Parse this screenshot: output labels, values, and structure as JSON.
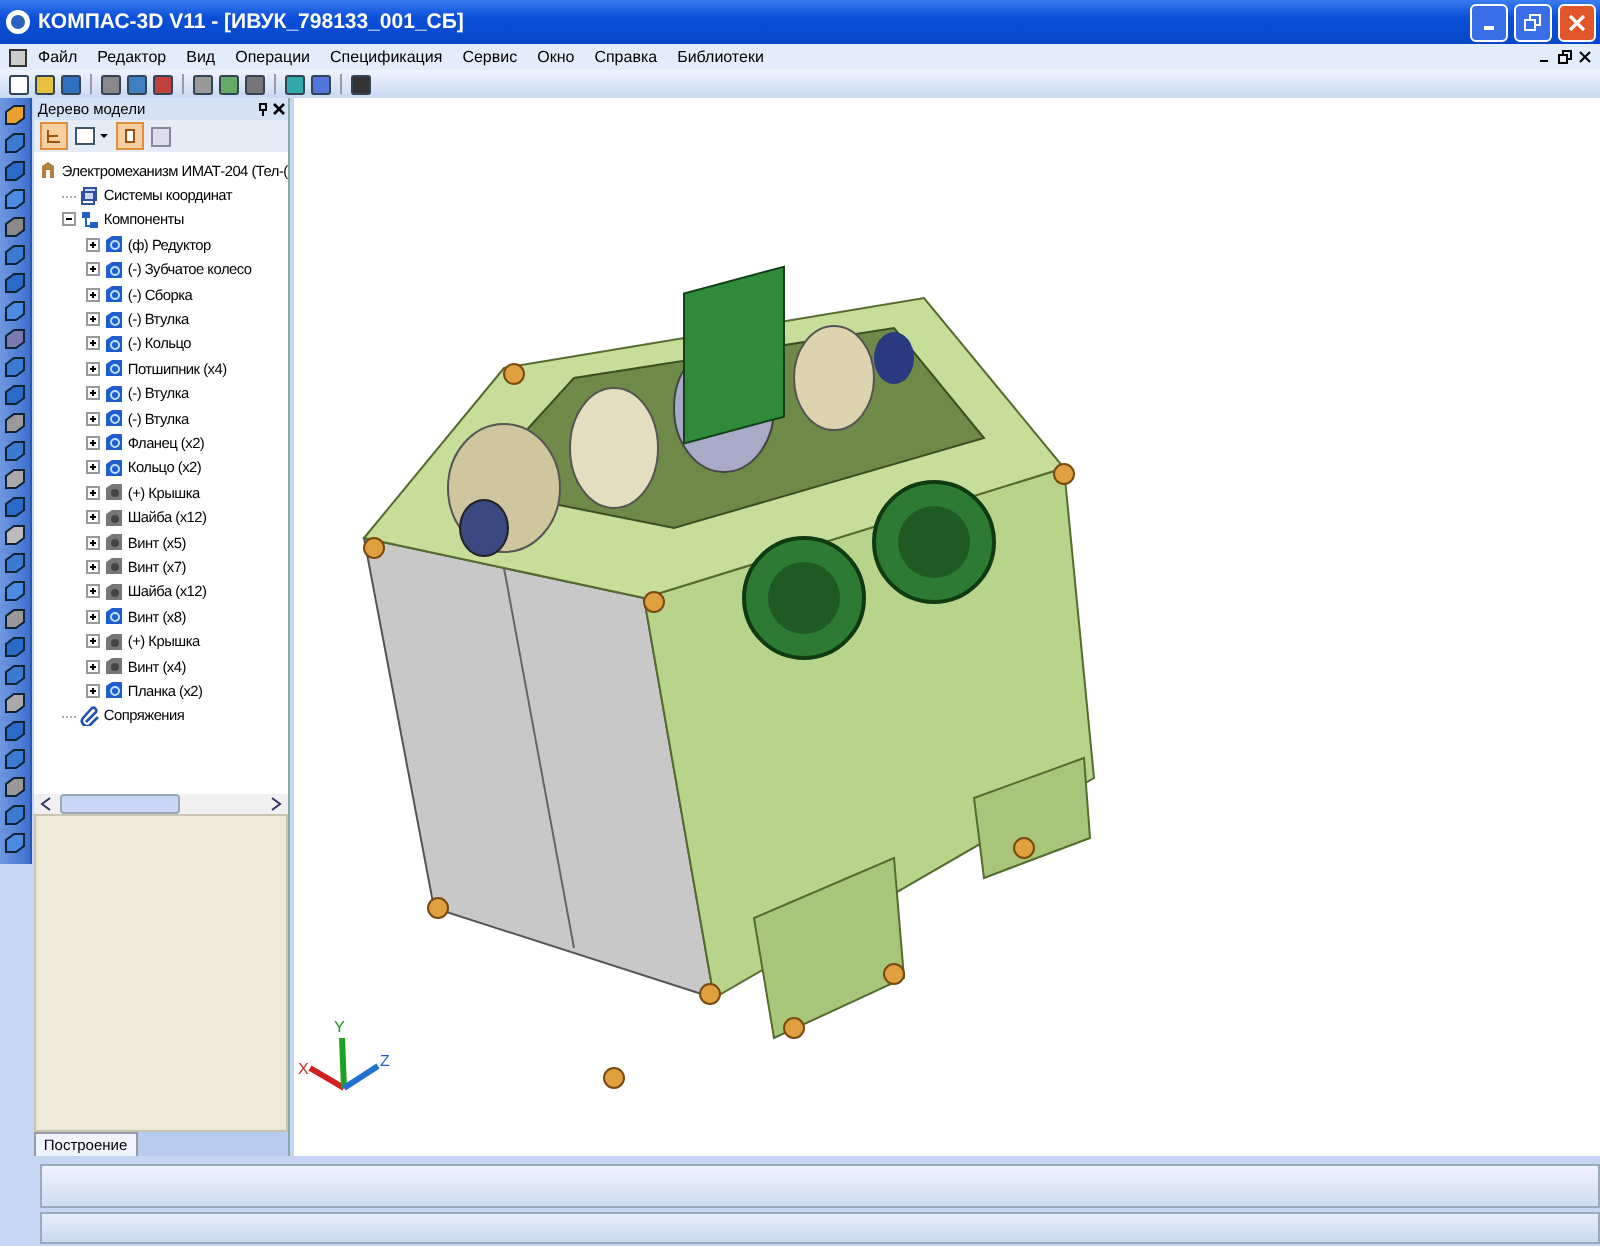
{
  "window": {
    "title": "КОМПАС-3D V11 - [ИВУК_798133_001_СБ]"
  },
  "menu": [
    "Файл",
    "Редактор",
    "Вид",
    "Операции",
    "Спецификация",
    "Сервис",
    "Окно",
    "Справка",
    "Библиотеки"
  ],
  "model_tree": {
    "title": "Дерево модели",
    "root": {
      "label": "Электромеханизм ИМАТ-204 (Тел-(",
      "kind": "assembly",
      "children": [
        {
          "label": "Системы координат",
          "kind": "coords"
        },
        {
          "label": "Компоненты",
          "kind": "group",
          "expanded": true,
          "children": [
            {
              "label": "(ф) Редуктор",
              "kind": "part",
              "expanded": false
            },
            {
              "label": "(-) Зубчатое колесо",
              "kind": "part",
              "expanded": false
            },
            {
              "label": "(-) Сборка",
              "kind": "part",
              "expanded": false
            },
            {
              "label": "(-) Втулка",
              "kind": "part",
              "expanded": false
            },
            {
              "label": "(-) Кольцо",
              "kind": "part",
              "expanded": false
            },
            {
              "label": "Потшипник (x4)",
              "kind": "part",
              "expanded": false
            },
            {
              "label": "(-) Втулка",
              "kind": "part",
              "expanded": false
            },
            {
              "label": "(-) Втулка",
              "kind": "part",
              "expanded": false
            },
            {
              "label": "Фланец (x2)",
              "kind": "part",
              "expanded": false
            },
            {
              "label": "Кольцо (x2)",
              "kind": "part",
              "expanded": false
            },
            {
              "label": "(+) Крышка",
              "kind": "standard",
              "expanded": false
            },
            {
              "label": "Шайба (x12)",
              "kind": "standard",
              "expanded": false
            },
            {
              "label": "Винт (x5)",
              "kind": "standard",
              "expanded": false
            },
            {
              "label": "Винт (x7)",
              "kind": "standard",
              "expanded": false
            },
            {
              "label": "Шайба (x12)",
              "kind": "standard",
              "expanded": false
            },
            {
              "label": "Винт (x8)",
              "kind": "part",
              "expanded": false
            },
            {
              "label": "(+) Крышка",
              "kind": "standard",
              "expanded": false
            },
            {
              "label": "Винт (x4)",
              "kind": "standard",
              "expanded": false
            },
            {
              "label": "Планка (x2)",
              "kind": "part",
              "expanded": false
            }
          ]
        },
        {
          "label": "Сопряжения",
          "kind": "mates"
        }
      ]
    }
  },
  "panel_tabs": [
    {
      "label": "Построение",
      "selected": true
    }
  ],
  "viewport": {
    "axis_labels": [
      "X",
      "Y",
      "Z"
    ]
  }
}
